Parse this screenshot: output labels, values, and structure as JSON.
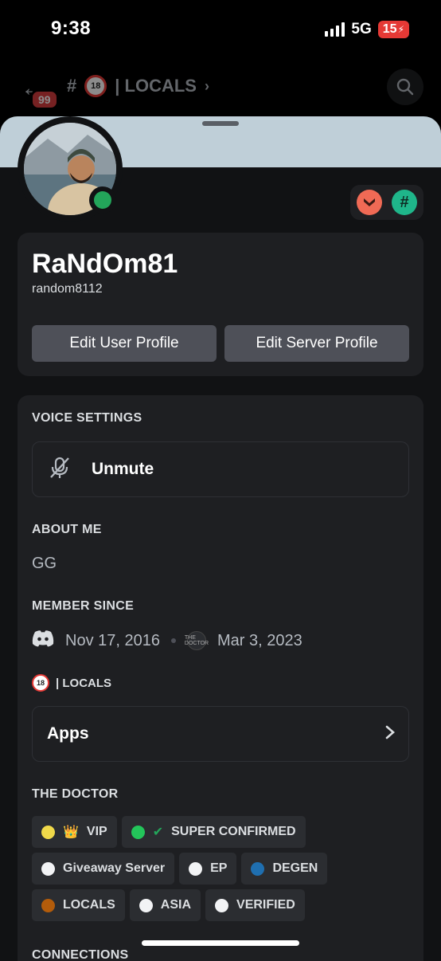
{
  "status": {
    "time": "9:38",
    "network": "5G",
    "battery": "15"
  },
  "channel": {
    "unread_badge": "99",
    "title": "| LOCALS"
  },
  "profile": {
    "display_name": "RaNdOm81",
    "username": "random8112",
    "edit_user_label": "Edit User Profile",
    "edit_server_label": "Edit Server Profile"
  },
  "voice": {
    "section_label": "VOICE SETTINGS",
    "unmute_label": "Unmute"
  },
  "about": {
    "section_label": "ABOUT ME",
    "text": "GG"
  },
  "member_since": {
    "section_label": "MEMBER SINCE",
    "discord_date": "Nov 17, 2016",
    "server_date": "Mar 3, 2023",
    "server_icon_text": "THE DOCTOR"
  },
  "locals": {
    "label": "| LOCALS"
  },
  "apps": {
    "label": "Apps"
  },
  "roles_section": {
    "label": "THE DOCTOR"
  },
  "roles": [
    {
      "name": "VIP",
      "color": "#f0d94a",
      "prefix": "👑"
    },
    {
      "name": "SUPER CONFIRMED",
      "color": "#23c55a",
      "prefix": "✔"
    },
    {
      "name": "Giveaway Server",
      "color": "#f2f3f5"
    },
    {
      "name": "EP",
      "color": "#f2f3f5"
    },
    {
      "name": "DEGEN",
      "color": "#1f6fb0"
    },
    {
      "name": "LOCALS",
      "color": "#b35c0b"
    },
    {
      "name": "ASIA",
      "color": "#f2f3f5"
    },
    {
      "name": "VERIFIED",
      "color": "#f2f3f5"
    }
  ],
  "connections": {
    "label": "CONNECTIONS"
  },
  "colors": {
    "accent": "#5865f2",
    "online": "#23a55a",
    "banner": "#bfcfd8"
  },
  "icons": [
    "back-arrow-icon",
    "hashtag-icon",
    "no-18-icon",
    "search-icon",
    "mic-off-icon",
    "discord-icon",
    "chevron-right-icon"
  ]
}
